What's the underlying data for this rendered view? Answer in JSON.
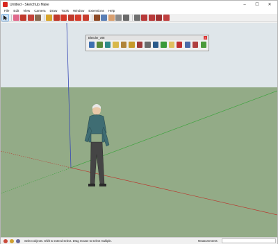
{
  "window": {
    "title": "Untitled - SketchUp Make",
    "controls": [
      "–",
      "☐",
      "✕"
    ]
  },
  "menu": [
    "File",
    "Edit",
    "View",
    "Camera",
    "Draw",
    "Tools",
    "Window",
    "Extensions",
    "Help"
  ],
  "toolbar": {
    "buttons": [
      {
        "name": "select-tool-icon",
        "color": "#e8e8e8",
        "selected": true
      },
      {
        "name": "eraser-icon",
        "color": "#e06a8c"
      },
      {
        "name": "pencil-icon",
        "color": "#c0392b"
      },
      {
        "name": "shapes-icon",
        "color": "#c4433a"
      },
      {
        "name": "push-pull-icon",
        "color": "#8a6a50"
      },
      {
        "name": "tape-measure-icon",
        "color": "#d8a52c"
      },
      {
        "name": "move-icon",
        "color": "#c0392b"
      },
      {
        "name": "rotate-icon",
        "color": "#d23a2a"
      },
      {
        "name": "offset-icon",
        "color": "#c0392b"
      },
      {
        "name": "follow-me-icon",
        "color": "#d63c2c"
      },
      {
        "name": "scale-icon",
        "color": "#c83d2e"
      },
      {
        "name": "paint-bucket-icon",
        "color": "#8e4a26"
      },
      {
        "name": "orbit-icon",
        "color": "#5a7fb5"
      },
      {
        "name": "pan-icon",
        "color": "#d9a070"
      },
      {
        "name": "zoom-icon",
        "color": "#8b8b8b"
      },
      {
        "name": "zoom-extents-icon",
        "color": "#6a6a6a"
      },
      {
        "name": "previous-view-icon",
        "color": "#707070"
      },
      {
        "name": "warehouse-icon",
        "color": "#b83a3a"
      },
      {
        "name": "extension-warehouse-icon",
        "color": "#b83a3a"
      },
      {
        "name": "send-to-layout-icon",
        "color": "#a03030"
      },
      {
        "name": "extension-manager-icon",
        "color": "#c04040"
      }
    ]
  },
  "floating_toolbar": {
    "title": "Blender_v08",
    "close": "×",
    "buttons": [
      {
        "name": "blender-run-icon",
        "color": "#3d6fb0"
      },
      {
        "name": "blender-sphere-icon",
        "color": "#5a8a3a"
      },
      {
        "name": "blender-globe-icon",
        "color": "#2e8a8a"
      },
      {
        "name": "blender-note-icon",
        "color": "#d8b84a"
      },
      {
        "name": "blender-bucket-icon",
        "color": "#b0843a"
      },
      {
        "name": "blender-lamp-icon",
        "color": "#c79a2a"
      },
      {
        "name": "blender-book-icon",
        "color": "#a03a3a"
      },
      {
        "name": "blender-component-icon",
        "color": "#6b6b6b"
      },
      {
        "name": "blender-eye-icon",
        "color": "#2a5a8a"
      },
      {
        "name": "blender-leaf-icon",
        "color": "#3a9a3a"
      },
      {
        "name": "blender-cloud-icon",
        "color": "#e0c060"
      },
      {
        "name": "blender-film-icon",
        "color": "#c03030"
      },
      {
        "name": "blender-panel-icon",
        "color": "#4a6aa8"
      },
      {
        "name": "blender-settings-icon",
        "color": "#b04040"
      },
      {
        "name": "blender-help-icon",
        "color": "#4a9a3a"
      }
    ]
  },
  "colors": {
    "sky": "#dfe6ea",
    "ground": "#93ab87",
    "red_axis": "#b83a2f",
    "green_axis": "#3fa33f",
    "blue_axis": "#3748b5"
  },
  "status": {
    "message": "Select objects. Shift to extend select. Drag mouse to select multiple.",
    "measurements_label": "Measurements",
    "measurements_value": ""
  }
}
